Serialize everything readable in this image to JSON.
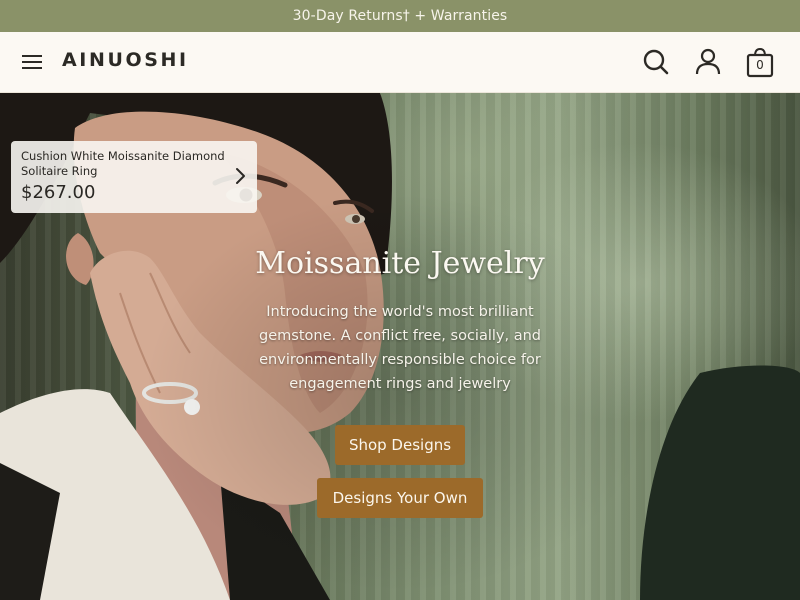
{
  "announcement": {
    "text": "30-Day Returns† + Warranties"
  },
  "header": {
    "logo": "AINUOSHI",
    "menu_icon": "hamburger-menu-icon",
    "search_icon": "search-icon",
    "account_icon": "account-icon",
    "cart_icon": "cart-icon",
    "cart_count": "0"
  },
  "product_card": {
    "name": "Cushion White Moissanite Diamond Solitaire Ring",
    "price": "$267.00",
    "icon": "chevron-right-icon"
  },
  "hero": {
    "title": "Moissanite Jewelry",
    "subtitle": "Introducing the world's most brilliant gemstone. A conflict free, socially, and environmentally responsible choice for engagement rings and jewelry",
    "primary_button": "Shop Designs",
    "secondary_button": "Designs Your Own"
  },
  "colors": {
    "announcement_bg": "#8a9268",
    "header_bg": "#fcf9f3",
    "button_bg": "#9c6a2a",
    "text_dark": "#2c2a25"
  }
}
